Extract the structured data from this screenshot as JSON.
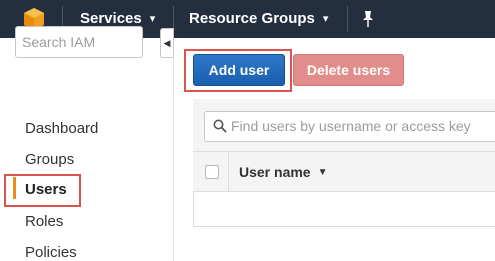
{
  "topbar": {
    "services_label": "Services",
    "resource_groups_label": "Resource Groups"
  },
  "sidebar": {
    "search_placeholder": "Search IAM",
    "items": [
      {
        "label": "Dashboard"
      },
      {
        "label": "Groups"
      },
      {
        "label": "Users"
      },
      {
        "label": "Roles"
      },
      {
        "label": "Policies"
      }
    ],
    "active_item": "Users"
  },
  "main": {
    "add_user_label": "Add user",
    "delete_users_label": "Delete users",
    "filter_placeholder": "Find users by username or access key",
    "columns": [
      {
        "label": "User name"
      }
    ]
  },
  "colors": {
    "topbar_bg": "#232f3e",
    "primary_button": "#2a6fbf",
    "disabled_delete": "#e08d8b",
    "active_accent": "#e88e1b",
    "highlight_box": "#d9534f"
  },
  "icons": {
    "logo": "aws-cube-icon",
    "pin": "pin-icon",
    "search": "magnifier-icon",
    "collapse": "caret-left-icon",
    "sort": "caret-down-icon"
  }
}
